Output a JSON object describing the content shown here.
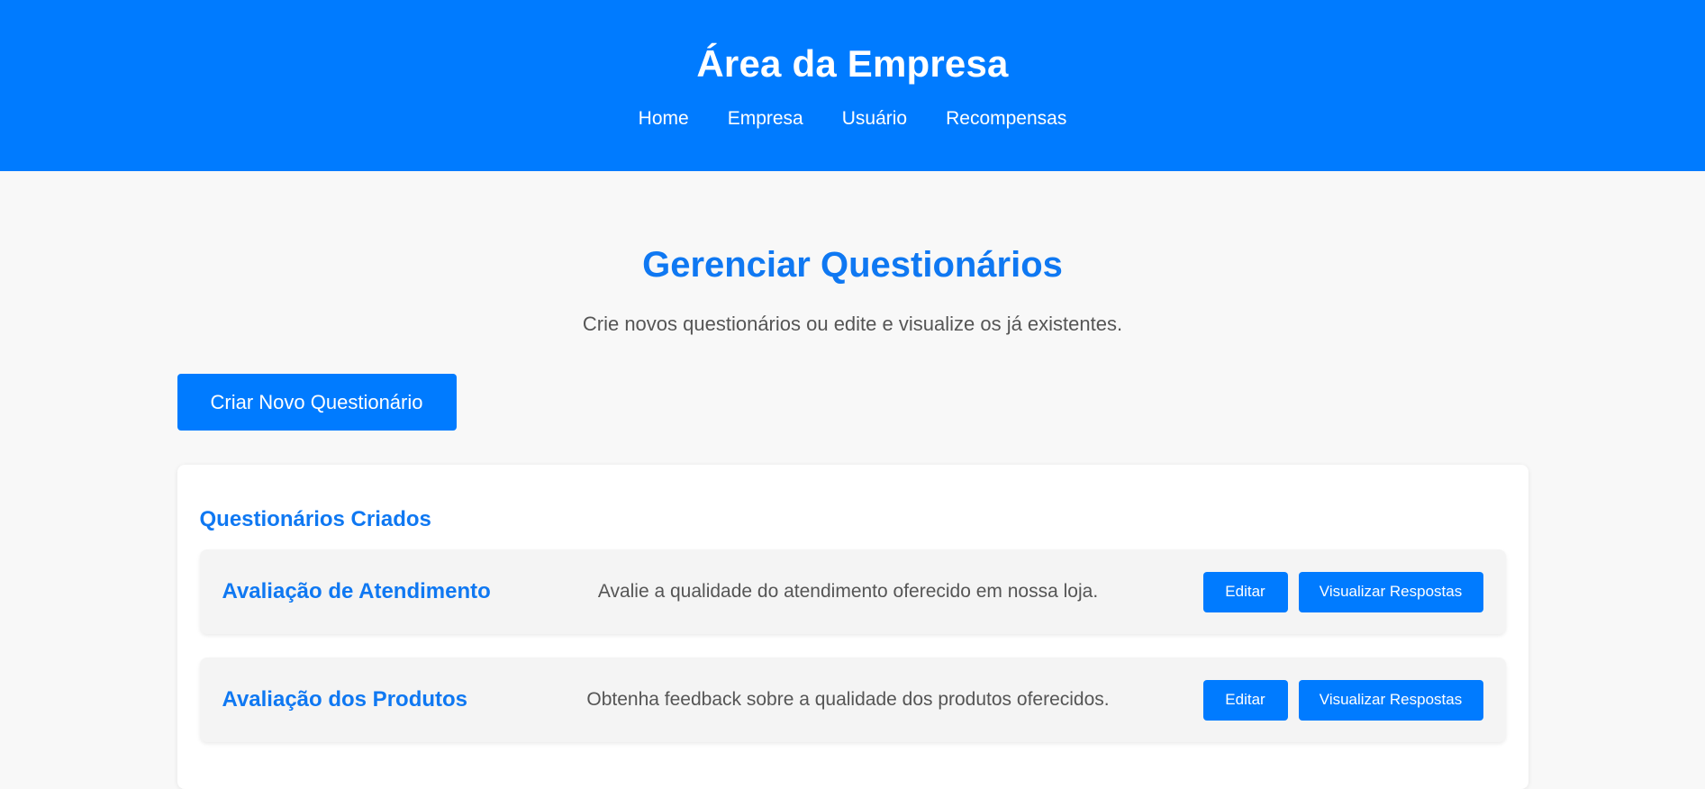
{
  "header": {
    "title": "Área da Empresa",
    "nav": [
      {
        "label": "Home"
      },
      {
        "label": "Empresa"
      },
      {
        "label": "Usuário"
      },
      {
        "label": "Recompensas"
      }
    ]
  },
  "main": {
    "title": "Gerenciar Questionários",
    "subtitle": "Crie novos questionários ou edite e visualize os já existentes.",
    "create_button_label": "Criar Novo Questionário",
    "panel": {
      "title": "Questionários Criados",
      "surveys": [
        {
          "title": "Avaliação de Atendimento",
          "description": "Avalie a qualidade do atendimento oferecido em nossa loja.",
          "edit_label": "Editar",
          "view_label": "Visualizar Respostas"
        },
        {
          "title": "Avaliação dos Produtos",
          "description": "Obtenha feedback sobre a qualidade dos produtos oferecidos.",
          "edit_label": "Editar",
          "view_label": "Visualizar Respostas"
        }
      ]
    }
  },
  "colors": {
    "primary": "#007bff",
    "heading": "#0f78f2",
    "background": "#f8f8f8",
    "card": "#ffffff",
    "item_background": "#f4f4f4",
    "text": "#555555"
  }
}
